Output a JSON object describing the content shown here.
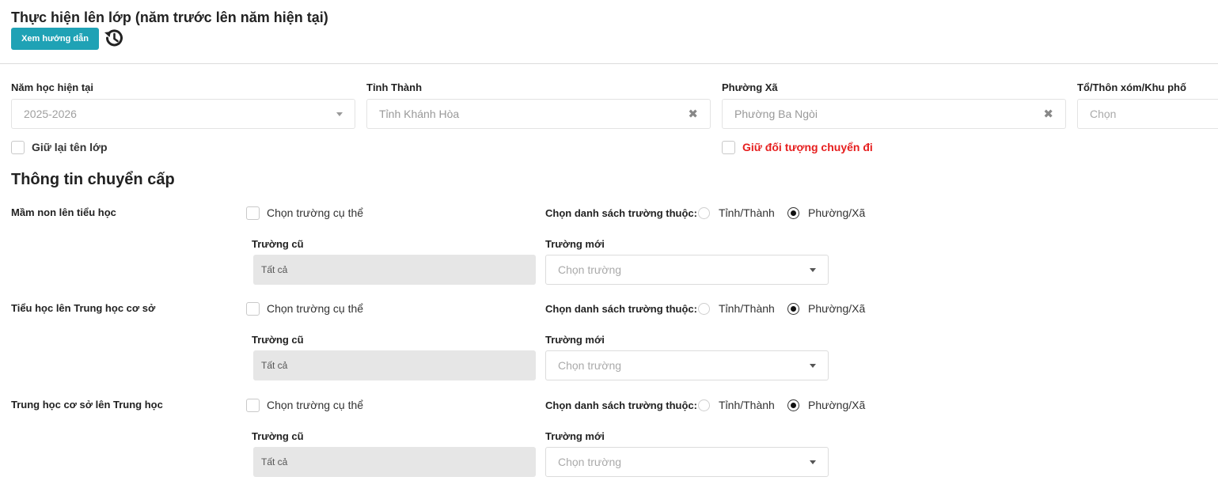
{
  "header": {
    "title": "Thực hiện lên lớp (năm trước lên năm hiện tại)",
    "guide_button": "Xem hướng dẫn",
    "history_icon": "history-icon"
  },
  "filters": {
    "school_year": {
      "label": "Năm học hiện tại",
      "value": "2025-2026"
    },
    "province": {
      "label": "Tỉnh Thành",
      "value": "Tỉnh Khánh Hòa"
    },
    "ward": {
      "label": "Phường Xã",
      "value": "Phường Ba Ngòi"
    },
    "hamlet": {
      "label": "Tổ/Thôn xóm/Khu phố",
      "placeholder": "Chọn"
    },
    "keep_class_name": "Giữ lại tên lớp",
    "keep_transfer": "Giữ đối tượng chuyển đi"
  },
  "transfer": {
    "title": "Thông tin chuyển cấp",
    "rows": [
      {
        "level": "Mầm non lên tiểu học",
        "choose_specific": "Chọn trường cụ thể",
        "list_label": "Chọn danh sách trường thuộc:",
        "option_province": "Tỉnh/Thành",
        "option_ward": "Phường/Xã",
        "selected": "ward",
        "old_label": "Trường cũ",
        "old_value": "Tất cả",
        "new_label": "Trường mới",
        "new_placeholder": "Chọn trường"
      },
      {
        "level": "Tiểu học lên Trung học cơ sở",
        "choose_specific": "Chọn trường cụ thể",
        "list_label": "Chọn danh sách trường thuộc:",
        "option_province": "Tỉnh/Thành",
        "option_ward": "Phường/Xã",
        "selected": "ward",
        "old_label": "Trường cũ",
        "old_value": "Tất cả",
        "new_label": "Trường mới",
        "new_placeholder": "Chọn trường"
      },
      {
        "level": "Trung học cơ sở lên Trung học",
        "choose_specific": "Chọn trường cụ thể",
        "list_label": "Chọn danh sách trường thuộc:",
        "option_province": "Tỉnh/Thành",
        "option_ward": "Phường/Xã",
        "selected": "ward",
        "old_label": "Trường cũ",
        "old_value": "Tất cả",
        "new_label": "Trường mới",
        "new_placeholder": "Chọn trường"
      }
    ]
  },
  "colors": {
    "accent": "#1fa2b5",
    "warning_text": "#e61e1e",
    "readonly_bg": "#e6e6e6"
  }
}
